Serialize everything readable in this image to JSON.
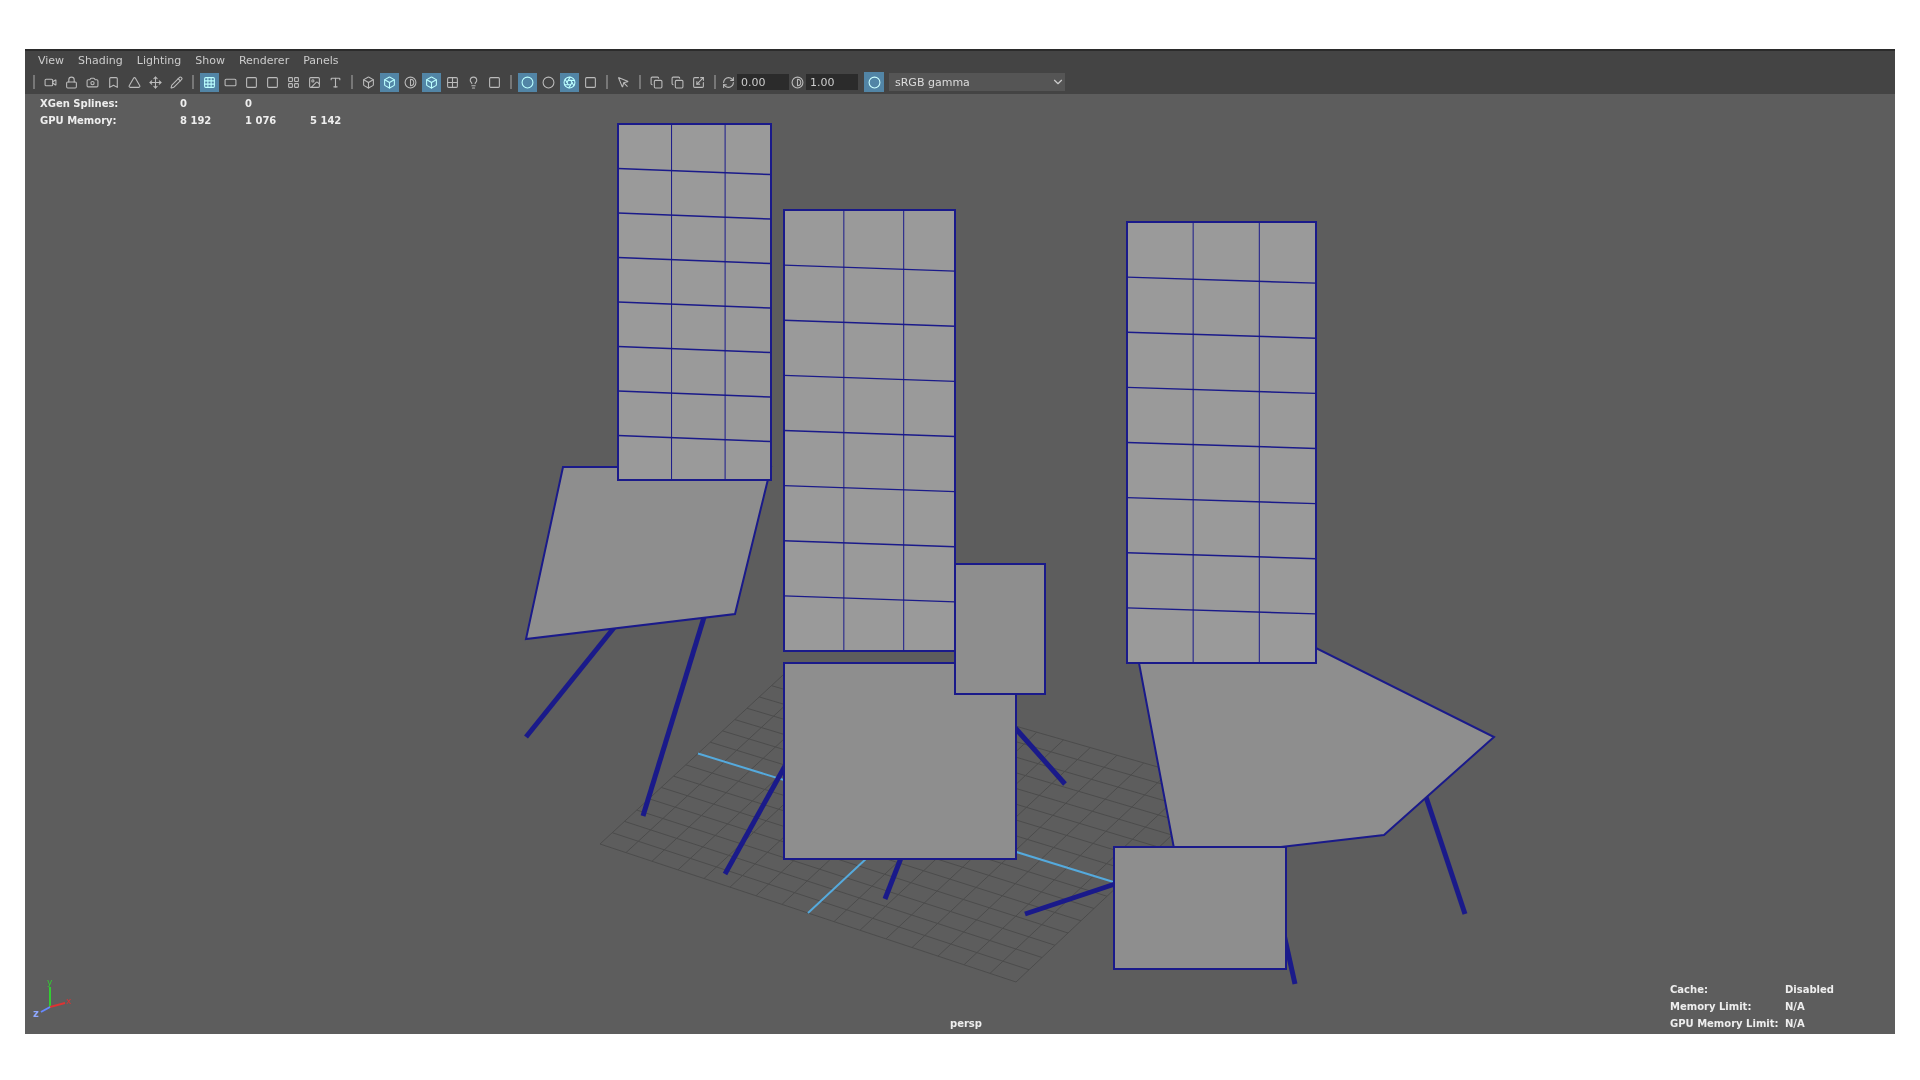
{
  "menu": [
    "View",
    "Shading",
    "Lighting",
    "Show",
    "Renderer",
    "Panels"
  ],
  "toolbar": {
    "groups": [
      {
        "buttons": [
          {
            "selected": false
          },
          {
            "selected": false
          },
          {
            "selected": false
          },
          {
            "selected": false
          },
          {
            "selected": false
          },
          {
            "selected": false
          },
          {
            "selected": false
          }
        ]
      },
      {
        "buttons": [
          {
            "selected": true
          },
          {
            "selected": false
          },
          {
            "selected": false
          },
          {
            "selected": false
          },
          {
            "selected": false
          },
          {
            "selected": false
          },
          {
            "selected": false
          }
        ]
      },
      {
        "buttons": [
          {
            "selected": false
          },
          {
            "selected": true
          },
          {
            "selected": false
          },
          {
            "selected": true
          },
          {
            "selected": false
          },
          {
            "selected": false
          },
          {
            "selected": false
          }
        ]
      },
      {
        "buttons": [
          {
            "selected": true
          },
          {
            "selected": false
          },
          {
            "selected": true
          },
          {
            "selected": false
          }
        ]
      },
      {
        "buttons": [
          {
            "selected": false
          }
        ]
      },
      {
        "buttons": [
          {
            "selected": false
          },
          {
            "selected": false
          },
          {
            "selected": false
          }
        ]
      }
    ],
    "exposure": "0.00",
    "gamma": "1.00",
    "color_management": {
      "on": true
    },
    "view_transform": "sRGB gamma"
  },
  "hud_stats": [
    {
      "label": "XGen Splines:",
      "values": [
        "0",
        "0"
      ]
    },
    {
      "label": "GPU Memory:",
      "values": [
        "8 192",
        "1 076",
        "5 142"
      ]
    }
  ],
  "cache_stats": [
    {
      "label": "Cache:",
      "value": "Disabled"
    },
    {
      "label": "Memory Limit:",
      "value": "N/A"
    },
    {
      "label": "GPU Memory Limit:",
      "value": "N/A"
    }
  ],
  "camera": "persp",
  "axis": {
    "x": "x",
    "y": "y",
    "z": "z"
  }
}
